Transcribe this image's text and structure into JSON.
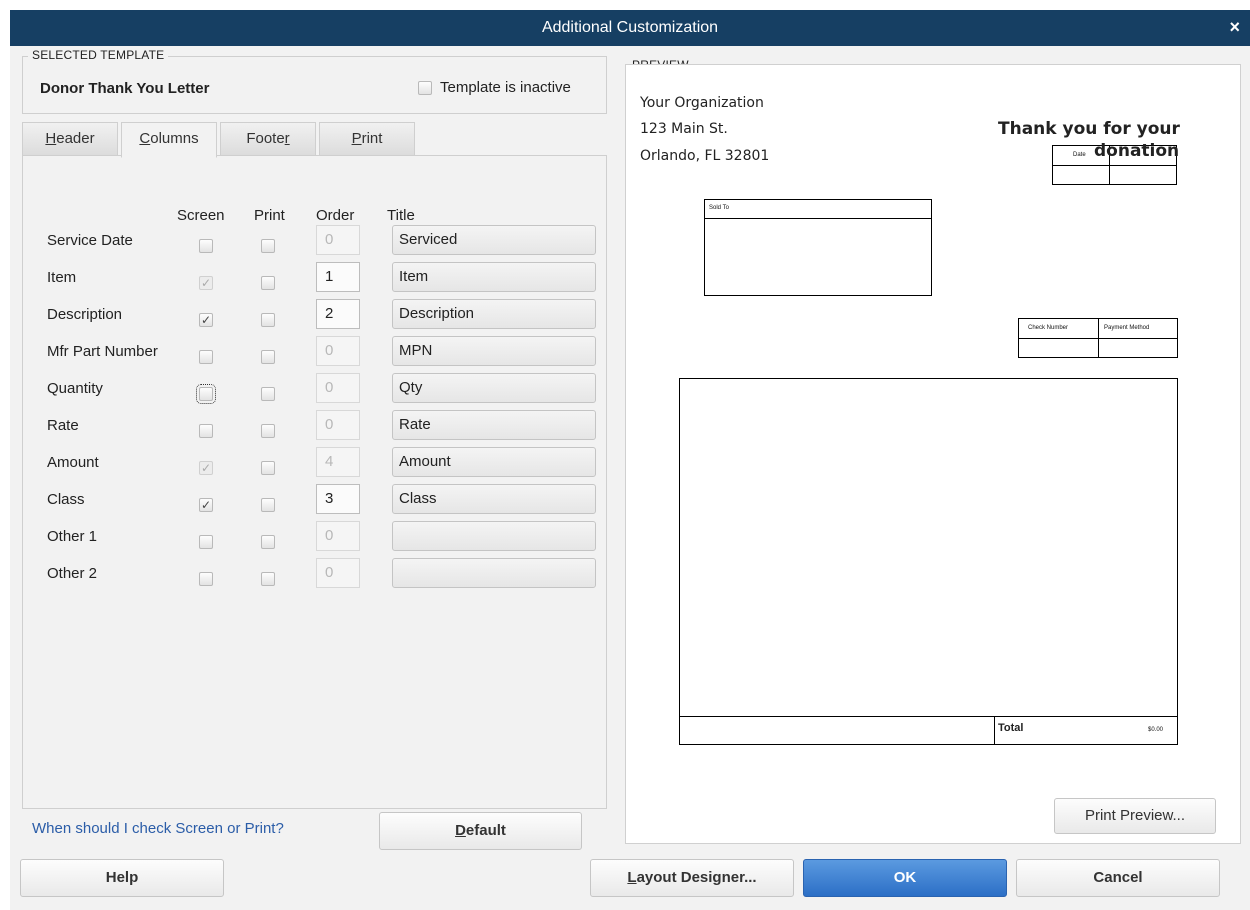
{
  "window": {
    "title": "Additional Customization",
    "close_glyph": "×"
  },
  "selected_template": {
    "legend": "SELECTED TEMPLATE",
    "name": "Donor Thank You Letter",
    "inactive_label": "Template is inactive",
    "inactive_checked": false
  },
  "tabs": [
    {
      "label": "Header",
      "mnemonic": "H",
      "rest": "eader",
      "active": false
    },
    {
      "label": "Columns",
      "mnemonic": "C",
      "rest": "olumns",
      "active": true
    },
    {
      "label": "Footer",
      "pre": "Foote",
      "mnemonic": "r",
      "active": false
    },
    {
      "label": "Print",
      "mnemonic": "P",
      "rest": "rint",
      "active": false
    }
  ],
  "columns": {
    "headers": {
      "screen": "Screen",
      "print": "Print",
      "order": "Order",
      "title": "Title"
    },
    "rows": [
      {
        "name": "Service Date",
        "screen": false,
        "screen_enabled": true,
        "print": false,
        "order": "0",
        "order_enabled": false,
        "title": "Serviced"
      },
      {
        "name": "Item",
        "screen": true,
        "screen_enabled": false,
        "print": false,
        "order": "1",
        "order_enabled": true,
        "title": "Item"
      },
      {
        "name": "Description",
        "screen": true,
        "screen_enabled": true,
        "print": false,
        "order": "2",
        "order_enabled": true,
        "title": "Description"
      },
      {
        "name": "Mfr Part Number",
        "screen": false,
        "screen_enabled": true,
        "print": false,
        "order": "0",
        "order_enabled": false,
        "title": "MPN"
      },
      {
        "name": "Quantity",
        "screen": false,
        "screen_enabled": true,
        "print": false,
        "order": "0",
        "order_enabled": false,
        "title": "Qty",
        "focused": true
      },
      {
        "name": "Rate",
        "screen": false,
        "screen_enabled": true,
        "print": false,
        "order": "0",
        "order_enabled": false,
        "title": "Rate"
      },
      {
        "name": "Amount",
        "screen": true,
        "screen_enabled": false,
        "print": false,
        "order": "4",
        "order_enabled": false,
        "title": "Amount"
      },
      {
        "name": "Class",
        "screen": true,
        "screen_enabled": true,
        "print": false,
        "order": "3",
        "order_enabled": true,
        "title": "Class"
      },
      {
        "name": "Other 1",
        "screen": false,
        "screen_enabled": true,
        "print": false,
        "order": "0",
        "order_enabled": false,
        "title": ""
      },
      {
        "name": "Other 2",
        "screen": false,
        "screen_enabled": true,
        "print": false,
        "order": "0",
        "order_enabled": false,
        "title": ""
      }
    ]
  },
  "help_link": "When should I check Screen or Print?",
  "default_button": {
    "mnemonic": "D",
    "rest": "efault"
  },
  "preview": {
    "legend": "PREVIEW",
    "org_name": "Your Organization",
    "org_address1": "123 Main St.",
    "org_address2": "Orlando, FL  32801",
    "doc_title_line1": "Thank you for your",
    "doc_title_line2": "donation",
    "date_label": "Date",
    "sold_to_label": "Sold To",
    "check_number_label": "Check Number",
    "payment_method_label": "Payment Method",
    "total_label": "Total",
    "total_value": "$0.00",
    "print_preview_button": "Print Preview..."
  },
  "buttons": {
    "help": "Help",
    "layout_designer": {
      "mnemonic": "L",
      "rest": "ayout Designer..."
    },
    "ok": "OK",
    "cancel": "Cancel"
  },
  "colors": {
    "titlebar": "#163f63",
    "ok_button": "#3a7bd0",
    "link": "#2b5da8"
  }
}
